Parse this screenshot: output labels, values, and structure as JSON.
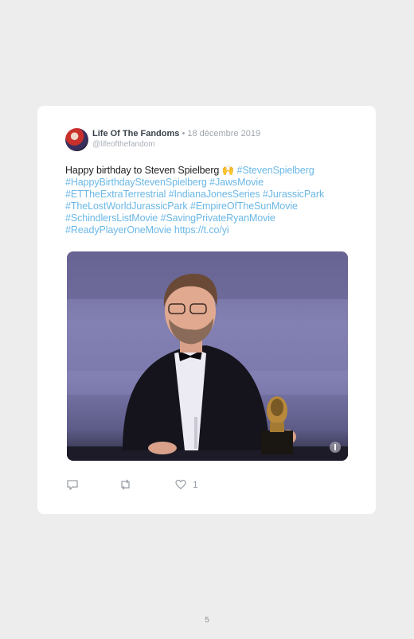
{
  "tweet": {
    "author_name": "Life Of The Fandoms",
    "date": " • 18 décembre 2019",
    "handle": "@lifeofthefandom",
    "text_prefix": "Happy birthday to Steven Spielberg ",
    "emoji": "🙌",
    "hashtags": [
      "#StevenSpielberg",
      "#HappyBirthdayStevenSpielberg",
      "#JawsMovie",
      "#ETTheExtraTerrestrial",
      "#IndianaJonesSeries",
      "#JurassicPark",
      "#TheLostWorldJurassicPark",
      "#EmpireOfTheSunMovie",
      "#SchindlersListMovie",
      "#SavingPrivateRyanMovie",
      "#ReadyPlayerOneMovie"
    ],
    "link": "https://t.co/yi",
    "like_count": "1"
  },
  "icons": {
    "reply": "reply-icon",
    "retweet": "retweet-icon",
    "like": "heart-icon",
    "info": "info-icon"
  },
  "colors": {
    "hashtag": "#6bb8e6",
    "background": "#ededed",
    "card": "#ffffff"
  },
  "page_number": "5"
}
